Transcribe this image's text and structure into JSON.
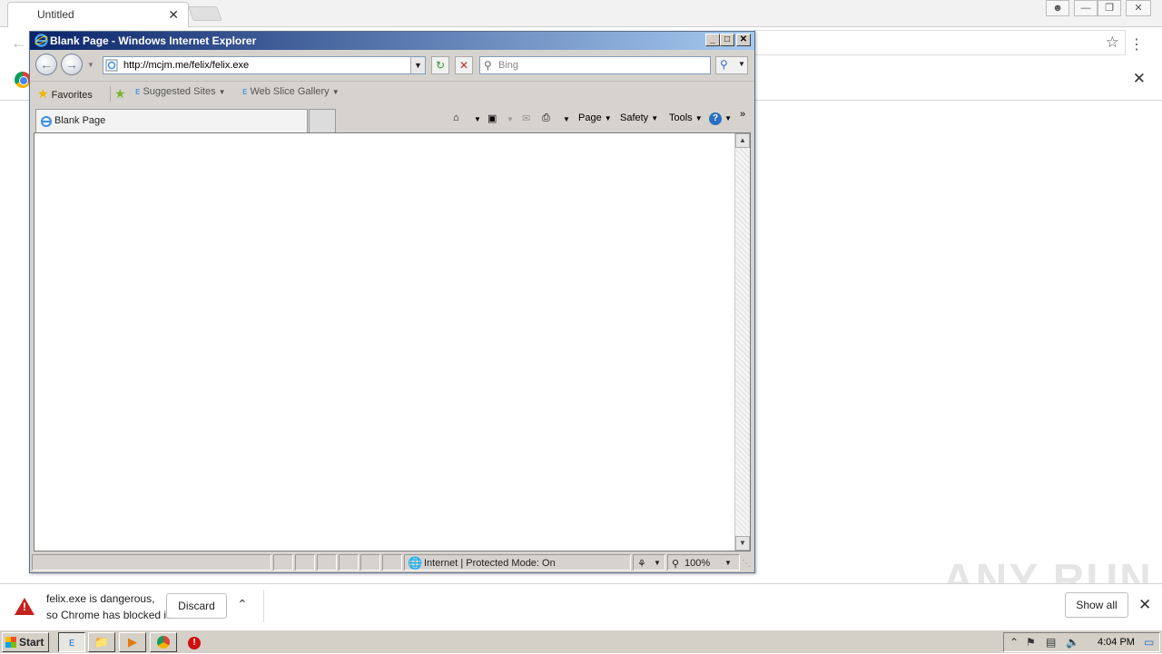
{
  "chrome": {
    "tab_title": "Untitled",
    "tab_close": "✕",
    "infobar_close": "✕"
  },
  "ie": {
    "window_title": "Blank Page - Windows Internet Explorer",
    "address": "http://mcjm.me/felix/felix.exe",
    "search_placeholder": "Bing",
    "favorites_label": "Favorites",
    "suggested_sites": "Suggested Sites",
    "web_slice_gallery": "Web Slice Gallery",
    "tab_label": "Blank Page",
    "cmd_page": "Page",
    "cmd_safety": "Safety",
    "cmd_tools": "Tools",
    "status_zone": "Internet | Protected Mode: On",
    "zoom": "100%"
  },
  "download": {
    "message_line1": "felix.exe is dangerous,",
    "message_line2": "so Chrome has blocked it.",
    "discard_label": "Discard",
    "show_all_label": "Show all",
    "close": "✕"
  },
  "watermark": "ANY RUN",
  "taskbar": {
    "start_label": "Start",
    "clock": "4:04 PM"
  }
}
